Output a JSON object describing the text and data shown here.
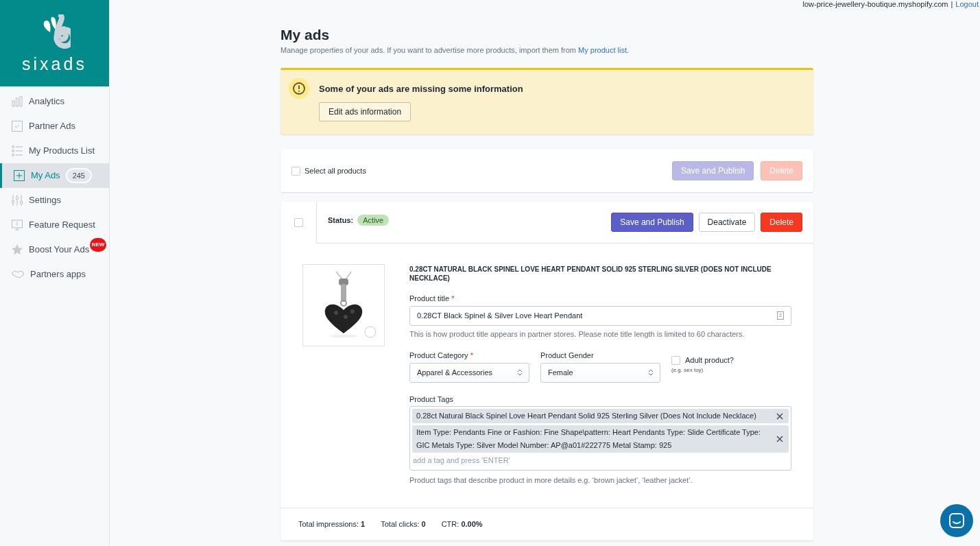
{
  "header": {
    "store": "low-price-jewellery-boutique.myshopify.com",
    "separator": "|",
    "logout": "Logout"
  },
  "sidebar": {
    "logo": "sixads",
    "items": [
      {
        "kind": "analytics",
        "label": "Analytics",
        "selected": false
      },
      {
        "kind": "partner",
        "label": "Partner Ads",
        "selected": false
      },
      {
        "kind": "list",
        "label": "My Products List",
        "selected": false
      },
      {
        "kind": "ads",
        "label": "My Ads",
        "selected": true,
        "count": "245"
      },
      {
        "kind": "settings",
        "label": "Settings",
        "selected": false
      },
      {
        "kind": "request",
        "label": "Feature Request",
        "selected": false
      },
      {
        "kind": "boost",
        "label": "Boost Your Ads",
        "selected": false,
        "badge": "NEW"
      },
      {
        "kind": "partners",
        "label": "Partners apps",
        "selected": false
      }
    ]
  },
  "page": {
    "title": "My ads",
    "subtitle": "Manage properties of your ads. If you want to advertise more products, import them from ",
    "subtitle_link": "My product list",
    "subtitle_end": "."
  },
  "alert": {
    "message": "Some of your ads are missing some information",
    "button": "Edit ads information"
  },
  "bulk_bar": {
    "select_all": "Select all products",
    "checked": false,
    "buttons": [
      {
        "kind": "primary",
        "label": "Save and Publish",
        "disabled": true
      },
      {
        "kind": "danger",
        "label": "Delete",
        "disabled": true
      }
    ]
  },
  "ad": {
    "checked": false,
    "status_label": "Status:",
    "status": "Active",
    "buttons": [
      {
        "kind": "primary",
        "label": "Save and Publish",
        "disabled": false
      },
      {
        "kind": "secondary",
        "label": "Deactivate",
        "disabled": false
      },
      {
        "kind": "danger",
        "label": "Delete",
        "disabled": false
      }
    ],
    "product_name": "0.28CT NATURAL BLACK SPINEL LOVE HEART PENDANT SOLID 925 STERLING SILVER (DOES NOT INCLUDE NECKLACE)",
    "title_label": "Product title",
    "title_required": "*",
    "title_value": "0.28CT Black Spinel & Silver Love Heart Pendant",
    "title_help": "This is how product title appears in partner stores. Please note title length is limited to 60 characters.",
    "category_label": "Product Category",
    "category_required": "*",
    "category_value": "Apparel & Accessories",
    "gender_label": "Product Gender",
    "gender_value": "Female",
    "adult_label": "Adult product?",
    "adult_hint": "(e.g. sex toy)",
    "adult_checked": false,
    "tags_label": "Product Tags",
    "tags": [
      "0.28ct Natural Black Spinel Love Heart Pendant Solid 925 Sterling Silver (Does Not Include Necklace)",
      "Item Type: Pendants Fine or Fashion: Fine Shape\\pattern: Heart Pendants Type: Slide Certificate Type: GIC Metals Type: Silver Model Number: AP@a01#222775 Metal Stamp: 925"
    ],
    "tags_placeholder": "add a tag and press 'ENTER'",
    "tags_help": "Product tags that describe product in more details e.g. ‘brown jacket’, ‘leather jacket’.",
    "stats": [
      {
        "label": "Total impressions:",
        "value": "1"
      },
      {
        "label": "Total clicks:",
        "value": "0"
      },
      {
        "label": "CTR:",
        "value": "0.00%"
      }
    ]
  }
}
